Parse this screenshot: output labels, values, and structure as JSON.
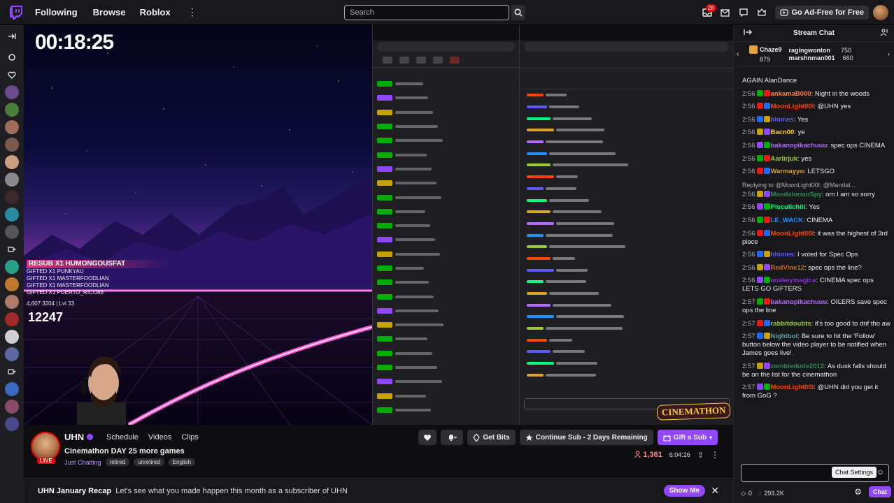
{
  "nav": {
    "following": "Following",
    "browse": "Browse",
    "roblox": "Roblox",
    "more": "⋮",
    "search_placeholder": "Search",
    "notif_badge": "28",
    "ad_free": "Go Ad-Free for Free"
  },
  "overlay": {
    "timer": "00:18:25",
    "alert_head": "RESUB X1 HUMONGOUSFAT",
    "alert_lines": [
      "GIFTED X1 PUNKYAU",
      "GIFTED X1 MASTERFOODLIAN",
      "GIFTED X1 MASTERFOODLIAN",
      "GIFTED X1 PUERTO_RICO86"
    ],
    "alert_stats": "4,607  3204 | Lvl 33",
    "sub_count": "12247",
    "cinemathon": "CINEMATHON"
  },
  "channel": {
    "name": "UHN",
    "tabs": [
      "Schedule",
      "Videos",
      "Clips"
    ],
    "title": "Cinemathon DAY 25 more games",
    "category": "Just Chatting",
    "tags": [
      "retired",
      "unretired",
      "English"
    ],
    "live": "LIVE",
    "get_bits": "Get Bits",
    "continue_sub": "Continue Sub - 2 Days Remaining",
    "gift_sub": "Gift a Sub",
    "viewers": "1,361",
    "uptime": "6:04:26"
  },
  "recap": {
    "title": "UHN January Recap",
    "text": "Let's see what you made happen this month as a subscriber of UHN",
    "show_me": "Show Me",
    "close": "✕"
  },
  "chat": {
    "header": "Stream Chat",
    "leaderboard": [
      {
        "name": "Chaze9",
        "amount": "879"
      },
      {
        "name": "ragingwonton",
        "amount": "750"
      },
      {
        "name": "marshnman001",
        "amount": "660"
      }
    ],
    "messages": [
      {
        "time": "",
        "user": "",
        "color": "#efeff1",
        "text": "AGAIN AlanDance"
      },
      {
        "time": "2:56",
        "user": "ankamaB000",
        "color": "#ff7f50",
        "text": "Night in the woods"
      },
      {
        "time": "2:56",
        "user": "MoonLight00l",
        "color": "#ff4500",
        "text": "@UHN yes"
      },
      {
        "time": "2:56",
        "user": "hhimes",
        "color": "#5a5aff",
        "text": "Yes"
      },
      {
        "time": "2:56",
        "user": "Bacn00",
        "color": "#ffd700",
        "text": "ye"
      },
      {
        "time": "2:56",
        "user": "bakanopikachuuu",
        "color": "#b36bff",
        "text": "spec ops CINEMA"
      },
      {
        "time": "2:56",
        "user": "Aarlirjuk",
        "color": "#9acd32",
        "text": "yes"
      },
      {
        "time": "2:56",
        "user": "Warmayyo",
        "color": "#daa520",
        "text": "LETSGO"
      },
      {
        "reply": "Replying to @MoonLight00l: @Mandal..."
      },
      {
        "time": "2:56",
        "user": "MandalorianSpy",
        "color": "#2e8b57",
        "text": "om I am so sorry"
      },
      {
        "time": "2:56",
        "user": "Pisculichiii",
        "color": "#00ff7f",
        "text": "Yes"
      },
      {
        "time": "2:56",
        "user": "LE_WACK",
        "color": "#1e90ff",
        "text": "CINEMA"
      },
      {
        "time": "2:56",
        "user": "MoonLight00l",
        "color": "#ff4500",
        "text": "it was the highest of 3rd place"
      },
      {
        "time": "2:56",
        "user": "hhimes",
        "color": "#5a5aff",
        "text": "I voted for Spec Ops"
      },
      {
        "time": "2:56",
        "user": "RedVine12",
        "color": "#d2691e",
        "text": "spec ops the line?"
      },
      {
        "time": "2:56",
        "user": "snakeymagica",
        "color": "#8a2be2",
        "text": "CINEMA spec ops LETS GO GIFTERS"
      },
      {
        "time": "2:57",
        "user": "bakanopikachuuu",
        "color": "#b36bff",
        "text": "OILERS save spec ops the line"
      },
      {
        "time": "2:57",
        "user": "rabbitdoubts",
        "color": "#9acd32",
        "text": "it's too good to dnf tho aw"
      },
      {
        "time": "2:57",
        "user": "Nightbot",
        "color": "#5f9ea0",
        "text": "Be sure to hit the 'Follow' button below the video player to be notified when James goes live!"
      },
      {
        "time": "2:57",
        "user": "zombiedude2012",
        "color": "#2e8b57",
        "text": "As dusk falls should be on the list for the cinemathon"
      },
      {
        "time": "2:57",
        "user": "MoonLight00l",
        "color": "#ff4500",
        "text": "@UHN did you get it from GoG ?"
      }
    ],
    "tooltip": "Chat Settings",
    "points": "0",
    "channel_points": "293.2K",
    "chat_button": "Chat"
  },
  "colors": {
    "accent": "#9147ff",
    "live": "#eb0400"
  }
}
